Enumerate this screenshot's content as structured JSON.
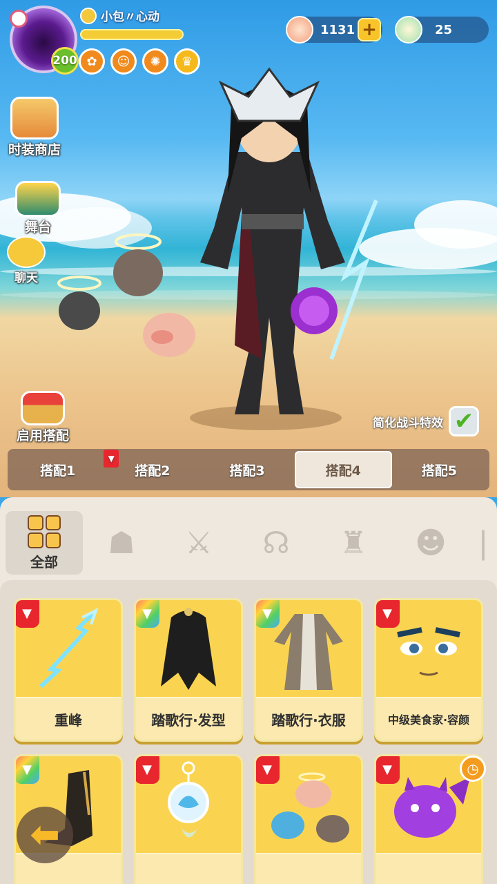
{
  "player": {
    "name": "小包〃心动",
    "level": "200",
    "badges": [
      "mushroom-badge-icon",
      "monkey-badge-icon",
      "swirl-badge-icon",
      "crown-badge-icon"
    ]
  },
  "currency": {
    "shells": "1131",
    "gems": "25"
  },
  "menu": {
    "shop_label": "时装商店",
    "stage_label": "舞台",
    "chat_label": "聊天",
    "apply_label": "启用搭配"
  },
  "simplify_label": "简化战斗特效",
  "simplify_checked": true,
  "tabs": [
    {
      "label": "搭配1",
      "active": false
    },
    {
      "label": "搭配2",
      "active": false,
      "marked": true
    },
    {
      "label": "搭配3",
      "active": false
    },
    {
      "label": "搭配4",
      "active": true
    },
    {
      "label": "搭配5",
      "active": false
    }
  ],
  "categories": {
    "all_label": "全部",
    "icons": [
      "mask-category-icon",
      "weapon-category-icon",
      "hair-category-icon",
      "clothes-category-icon",
      "face-category-icon",
      "more-category-icon"
    ]
  },
  "items": [
    {
      "label": "重峰",
      "icon": "lightning-staff-icon"
    },
    {
      "label": "踏歌行·发型",
      "icon": "long-hair-icon"
    },
    {
      "label": "踏歌行·衣服",
      "icon": "robe-icon"
    },
    {
      "label": "中级美食家·容颜",
      "icon": "face-icon"
    },
    {
      "label": "",
      "icon": "boots-icon"
    },
    {
      "label": "",
      "icon": "lotus-pendant-icon"
    },
    {
      "label": "",
      "icon": "angel-pigs-icon"
    },
    {
      "label": "",
      "icon": "purple-devil-pet-icon"
    }
  ],
  "colors": {
    "accent": "#fad451",
    "flag": "#e8262e",
    "panel": "#efe8de"
  }
}
